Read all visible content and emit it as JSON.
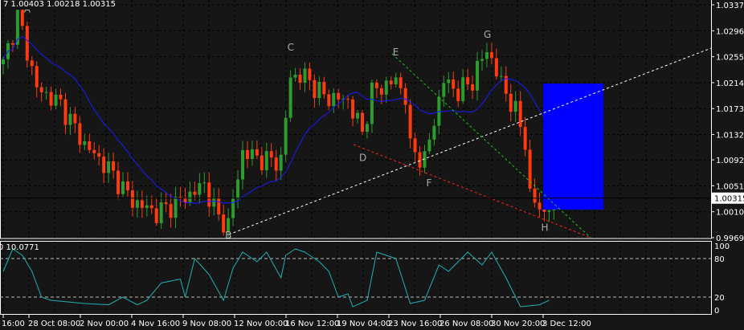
{
  "header": {
    "ohlc_text": "7 1.00403 1.00218 1.00315",
    "indicator_text": "0 10.0771"
  },
  "colors": {
    "bull": "#2e9b2e",
    "bear": "#ff3a10",
    "ma": "#1a1aff",
    "box": "#0000ff",
    "osc": "#20b0b0"
  },
  "chart_data": [
    {
      "type": "candlestick",
      "title": "",
      "y_ticks": [
        "1.03370",
        "1.02960",
        "1.02550",
        "1.02140",
        "1.01730",
        "1.01320",
        "1.00920",
        "1.00510",
        "1.00100",
        "0.99690"
      ],
      "ylim": [
        0.9969,
        1.0337
      ],
      "current_price": "1.00315",
      "x_ticks": [
        "16:00",
        "28 Oct 08:00",
        "2 Nov 00:00",
        "4 Nov 16:00",
        "9 Nov 08:00",
        "12 Nov 00:00",
        "16 Nov 12:00",
        "19 Nov 04:00",
        "23 Nov 16:00",
        "26 Nov 08:00",
        "30 Nov 20:00",
        "3 Dec 12:00"
      ],
      "close_keypoints": [
        [
          0,
          1.0243
        ],
        [
          3,
          1.0319
        ],
        [
          4,
          1.0294
        ],
        [
          7,
          1.0205
        ],
        [
          12,
          1.018
        ],
        [
          17,
          1.0116
        ],
        [
          22,
          1.0078
        ],
        [
          27,
          1.0027
        ],
        [
          32,
          1.0008
        ],
        [
          37,
          1.0027
        ],
        [
          42,
          1.0053
        ],
        [
          45,
          1.0
        ],
        [
          47,
          0.999
        ],
        [
          50,
          1.0104
        ],
        [
          55,
          1.0091
        ],
        [
          58,
          1.0091
        ],
        [
          60,
          1.0224
        ],
        [
          63,
          1.0224
        ],
        [
          67,
          1.0192
        ],
        [
          72,
          1.0186
        ],
        [
          75,
          1.0135
        ],
        [
          77,
          1.0199
        ],
        [
          82,
          1.0218
        ],
        [
          84,
          1.0192
        ],
        [
          85,
          1.011
        ],
        [
          88,
          1.0091
        ],
        [
          92,
          1.0218
        ],
        [
          95,
          1.0199
        ],
        [
          98,
          1.0218
        ],
        [
          101,
          1.0268
        ],
        [
          103,
          1.023
        ],
        [
          107,
          1.0167
        ],
        [
          109,
          1.0123
        ],
        [
          110,
          1.0034
        ],
        [
          113,
          1.0008
        ],
        [
          115,
          1.0031
        ]
      ],
      "pattern_labels": [
        {
          "label": "A",
          "bar": 5,
          "price": 1.033
        },
        {
          "label": "B",
          "bar": 47,
          "price": 0.9973
        },
        {
          "label": "C",
          "bar": 60,
          "price": 1.027
        },
        {
          "label": "D",
          "bar": 75,
          "price": 1.0095
        },
        {
          "label": "E",
          "bar": 82,
          "price": 1.0262
        },
        {
          "label": "F",
          "bar": 89,
          "price": 1.0055
        },
        {
          "label": "G",
          "bar": 101,
          "price": 1.029
        },
        {
          "label": "H",
          "bar": 113,
          "price": 0.9985
        }
      ]
    },
    {
      "type": "line",
      "title": "Stochastic",
      "y_ticks": [
        "100",
        "80",
        "20",
        "0"
      ],
      "levels": [
        80,
        20
      ],
      "ylim": [
        0,
        100
      ],
      "keypoints": [
        [
          0,
          60
        ],
        [
          2,
          95
        ],
        [
          4,
          85
        ],
        [
          6,
          60
        ],
        [
          8,
          20
        ],
        [
          10,
          15
        ],
        [
          17,
          10
        ],
        [
          22,
          8
        ],
        [
          25,
          20
        ],
        [
          28,
          8
        ],
        [
          30,
          15
        ],
        [
          33,
          42
        ],
        [
          37,
          48
        ],
        [
          38,
          20
        ],
        [
          40,
          80
        ],
        [
          43,
          55
        ],
        [
          46,
          15
        ],
        [
          48,
          65
        ],
        [
          50,
          90
        ],
        [
          53,
          75
        ],
        [
          55,
          90
        ],
        [
          58,
          50
        ],
        [
          59,
          85
        ],
        [
          61,
          95
        ],
        [
          63,
          90
        ],
        [
          66,
          75
        ],
        [
          68,
          60
        ],
        [
          70,
          20
        ],
        [
          72,
          25
        ],
        [
          73,
          5
        ],
        [
          76,
          15
        ],
        [
          78,
          90
        ],
        [
          82,
          80
        ],
        [
          85,
          10
        ],
        [
          88,
          15
        ],
        [
          91,
          70
        ],
        [
          93,
          60
        ],
        [
          97,
          90
        ],
        [
          100,
          70
        ],
        [
          102,
          90
        ],
        [
          105,
          50
        ],
        [
          108,
          5
        ],
        [
          112,
          8
        ],
        [
          114,
          15
        ]
      ]
    }
  ]
}
